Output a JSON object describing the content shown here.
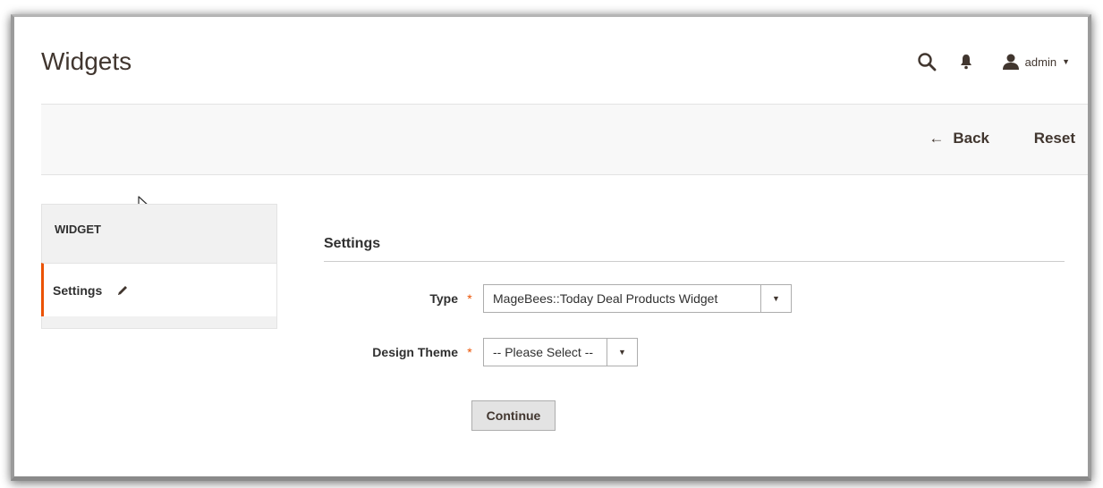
{
  "header": {
    "title": "Widgets",
    "user_name": "admin",
    "icons": [
      "search-icon",
      "bell-icon",
      "user-icon",
      "caret-down-icon"
    ]
  },
  "action_bar": {
    "back_label": "Back",
    "back_icon": "arrow-left-icon",
    "reset_label": "Reset"
  },
  "sidebar": {
    "section_title": "WIDGET",
    "items": [
      {
        "label": "Settings",
        "icon": "pencil-icon",
        "active": true
      }
    ]
  },
  "main": {
    "section_title": "Settings",
    "fields": [
      {
        "label": "Type",
        "required": true,
        "value": "MageBees::Today Deal Products Widget"
      },
      {
        "label": "Design Theme",
        "required": true,
        "value": "-- Please Select --"
      }
    ],
    "continue_label": "Continue"
  },
  "colors": {
    "accent": "#eb5202",
    "text": "#303030",
    "action_bar_bg": "#f8f8f8"
  }
}
